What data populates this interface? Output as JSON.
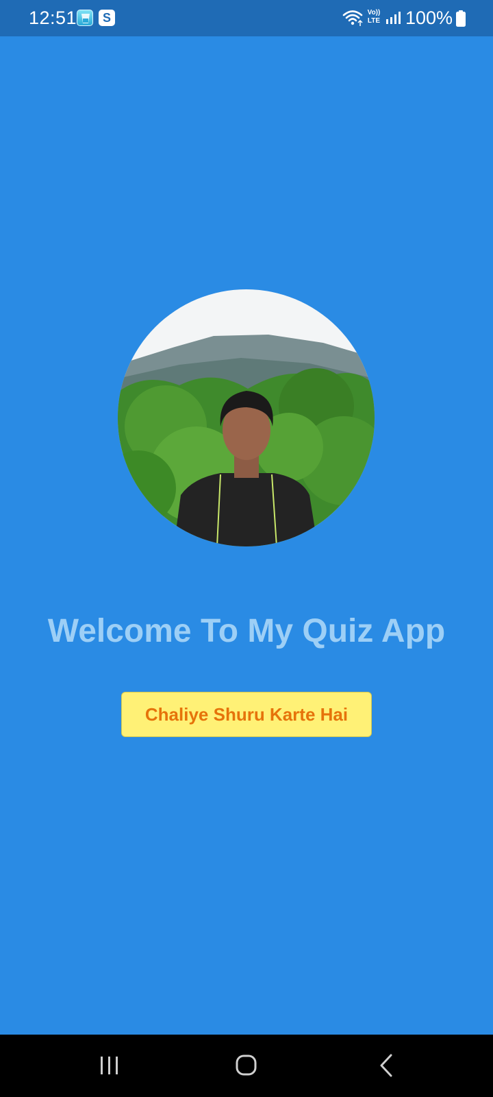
{
  "status_bar": {
    "time": "12:51",
    "notification_icons": [
      "water-reminder-app-icon",
      "s-message-app-icon"
    ],
    "notification_badge_letter": "S",
    "volte_top": "Vo))",
    "volte_bottom": "LTE",
    "battery_percent": "100%"
  },
  "welcome": {
    "title": "Welcome To My Quiz App",
    "button_label": "Chaliye Shuru Karte Hai"
  },
  "colors": {
    "background": "#2a8be4",
    "status_bar": "#1f6bb5",
    "title_text": "#9dcff6",
    "button_bg": "#fff176",
    "button_text": "#e6730a"
  },
  "nav_bar": {
    "buttons": [
      "recents-icon",
      "home-icon",
      "back-icon"
    ]
  }
}
